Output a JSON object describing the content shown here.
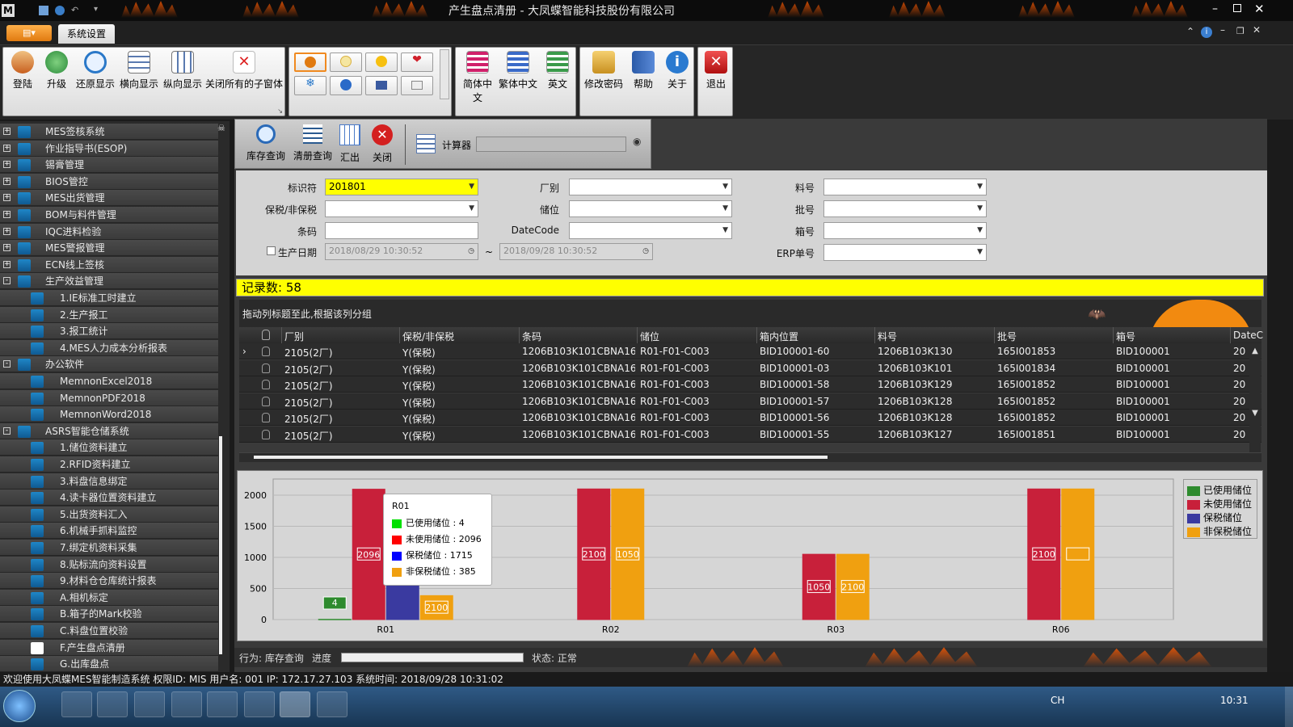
{
  "window": {
    "title": "产生盘点清册 - 大凤蝶智能科技股份有限公司"
  },
  "menu": {
    "tab": "系统设置"
  },
  "ribbon": {
    "group1": [
      "登陆",
      "升级",
      "还原显示",
      "横向显示",
      "纵向显示",
      "关闭所有的子窗体"
    ],
    "group3": [
      "简体中文",
      "繁体中文",
      "英文"
    ],
    "group4": [
      "修改密码",
      "帮助",
      "关于"
    ],
    "group5": [
      "退出"
    ]
  },
  "sidebar": {
    "items": [
      {
        "label": "MES签核系统",
        "level": 0,
        "exp": "+"
      },
      {
        "label": "作业指导书(ESOP)",
        "level": 0,
        "exp": "+"
      },
      {
        "label": "锡膏管理",
        "level": 0,
        "exp": "+"
      },
      {
        "label": "BIOS管控",
        "level": 0,
        "exp": "+"
      },
      {
        "label": "MES出货管理",
        "level": 0,
        "exp": "+"
      },
      {
        "label": "BOM与料件管理",
        "level": 0,
        "exp": "+"
      },
      {
        "label": "IQC进料检验",
        "level": 0,
        "exp": "+"
      },
      {
        "label": "MES警报管理",
        "level": 0,
        "exp": "+"
      },
      {
        "label": "ECN线上签核",
        "level": 0,
        "exp": "+"
      },
      {
        "label": "生产效益管理",
        "level": 0,
        "exp": "-"
      },
      {
        "label": "1.IE标准工时建立",
        "level": 1
      },
      {
        "label": "2.生产报工",
        "level": 1
      },
      {
        "label": "3.报工统计",
        "level": 1
      },
      {
        "label": "4.MES人力成本分析报表",
        "level": 1
      },
      {
        "label": "办公软件",
        "level": 0,
        "exp": "-"
      },
      {
        "label": "MemnonExcel2018",
        "level": 1
      },
      {
        "label": "MemnonPDF2018",
        "level": 1
      },
      {
        "label": "MemnonWord2018",
        "level": 1
      },
      {
        "label": "ASRS智能仓储系统",
        "level": 0,
        "exp": "-"
      },
      {
        "label": "1.储位资料建立",
        "level": 1
      },
      {
        "label": "2.RFID资料建立",
        "level": 1
      },
      {
        "label": "3.料盘信息绑定",
        "level": 1
      },
      {
        "label": "4.读卡器位置资料建立",
        "level": 1
      },
      {
        "label": "5.出货资料汇入",
        "level": 1
      },
      {
        "label": "6.机械手抓料监控",
        "level": 1
      },
      {
        "label": "7.绑定机资料采集",
        "level": 1
      },
      {
        "label": "8.贴标流向资料设置",
        "level": 1
      },
      {
        "label": "9.材料仓仓库统计报表",
        "level": 1
      },
      {
        "label": "A.相机标定",
        "level": 1
      },
      {
        "label": "B.箱子的Mark校验",
        "level": 1
      },
      {
        "label": "C.料盘位置校验",
        "level": 1
      },
      {
        "label": "F.产生盘点清册",
        "level": 1
      },
      {
        "label": "G.出库盘点",
        "level": 1
      }
    ]
  },
  "toolbar": {
    "query": "库存查询",
    "list_query": "清册查询",
    "summary": "汇出",
    "close": "关闭",
    "calc": "计算器"
  },
  "form": {
    "tag_label": "标识符",
    "tag_value": "201801",
    "bond_label": "保税/非保税",
    "barcode_label": "条码",
    "prod_date_label": "生产日期",
    "date_from": "2018/08/29 10:30:52",
    "tilde": "~",
    "date_to": "2018/09/28 10:30:52",
    "factory_label": "厂别",
    "storage_label": "储位",
    "datecode_label": "DateCode",
    "part_label": "料号",
    "lot_label": "批号",
    "box_label": "箱号",
    "erp_label": "ERP单号"
  },
  "records": {
    "text": "记录数: 58"
  },
  "grid": {
    "group_hint": "拖动列标题至此,根据该列分组",
    "headers": [
      "厂别",
      "保税/非保税",
      "条码",
      "储位",
      "箱内位置",
      "料号",
      "批号",
      "箱号",
      "DateC"
    ],
    "rows": [
      [
        "2105(2厂)",
        "Y(保税)",
        "1206B103K101CBNA16...",
        "R01-F01-C003",
        "BID100001-60",
        "1206B103K130",
        "165I001853",
        "BID100001",
        "20"
      ],
      [
        "2105(2厂)",
        "Y(保税)",
        "1206B103K101CBNA16...",
        "R01-F01-C003",
        "BID100001-03",
        "1206B103K101",
        "165I001834",
        "BID100001",
        "20"
      ],
      [
        "2105(2厂)",
        "Y(保税)",
        "1206B103K101CBNA16...",
        "R01-F01-C003",
        "BID100001-58",
        "1206B103K129",
        "165I001852",
        "BID100001",
        "20"
      ],
      [
        "2105(2厂)",
        "Y(保税)",
        "1206B103K101CBNA16...",
        "R01-F01-C003",
        "BID100001-57",
        "1206B103K128",
        "165I001852",
        "BID100001",
        "20"
      ],
      [
        "2105(2厂)",
        "Y(保税)",
        "1206B103K101CBNA16...",
        "R01-F01-C003",
        "BID100001-56",
        "1206B103K128",
        "165I001852",
        "BID100001",
        "20"
      ],
      [
        "2105(2厂)",
        "Y(保税)",
        "1206B103K101CBNA16...",
        "R01-F01-C003",
        "BID100001-55",
        "1206B103K127",
        "165I001851",
        "BID100001",
        "20"
      ]
    ]
  },
  "chart_data": {
    "type": "bar",
    "categories": [
      "R01",
      "R02",
      "R03",
      "R06"
    ],
    "series": [
      {
        "name": "已使用储位",
        "values": [
          4,
          null,
          null,
          null
        ],
        "color": "#2e8b2e"
      },
      {
        "name": "未使用储位",
        "values": [
          2096,
          2100,
          1050,
          2100
        ],
        "color": "#c8203a"
      },
      {
        "name": "保税储位",
        "values": [
          1715,
          null,
          null,
          null
        ],
        "color": "#3a3aa0"
      },
      {
        "name": "非保税储位",
        "values": [
          385,
          2100,
          1050,
          2100
        ],
        "color": "#f0a010"
      }
    ],
    "data_labels": [
      "4",
      "2096",
      "385",
      "2100",
      "2100",
      "1050",
      "1050",
      "2100",
      "2100"
    ],
    "ylim": [
      0,
      2000
    ],
    "yticks": [
      "2000",
      "1500",
      "1000",
      "500",
      "0"
    ],
    "legend": "top-right",
    "tooltip": {
      "title": "R01",
      "lines": [
        "已使用储位 : 4",
        "未使用储位 : 2096",
        "保税储位 : 1715",
        "非保税储位 : 385"
      ]
    }
  },
  "status": {
    "action": "行为: 库存查询",
    "progress_label": "进度",
    "state": "状态: 正常"
  },
  "bottom": {
    "info": "欢迎使用大凤蝶MES智能制造系统 权限ID: MIS 用户名: 001 IP: 172.17.27.103 系统时间: 2018/09/28 10:31:02"
  },
  "taskbar": {
    "time": "10:31",
    "lang": "CH"
  }
}
